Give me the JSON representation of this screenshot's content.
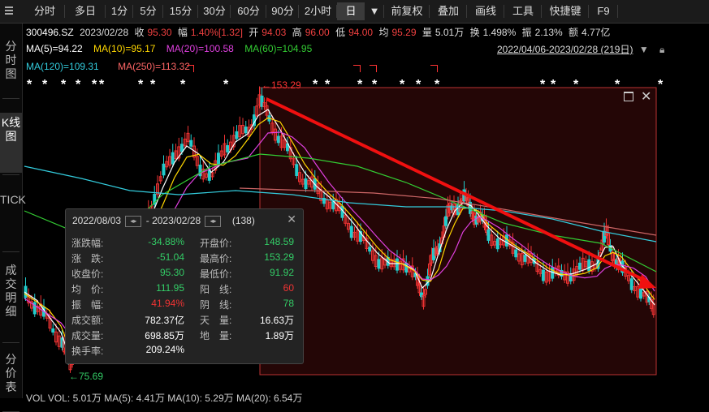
{
  "toolbar": {
    "items": [
      "分时",
      "多日",
      "1分",
      "5分",
      "15分",
      "30分",
      "60分",
      "90分",
      "2小时",
      "日",
      "▼",
      "前复权",
      "叠加",
      "画线",
      "工具",
      "快捷键",
      "F9"
    ],
    "active_index": 9
  },
  "sidebar": [
    "分时图",
    "K线图",
    "TICK",
    "成交明细",
    "分价表"
  ],
  "quote": {
    "code": "300496.SZ",
    "date": "2023/02/28",
    "close_label": "收",
    "close": "95.30",
    "chg_label": "幅",
    "chg": "1.40%[1.32]",
    "open_label": "开",
    "open": "94.03",
    "high_label": "高",
    "high": "96.00",
    "low_label": "低",
    "low": "94.00",
    "avg_label": "均",
    "avg": "95.29",
    "vol_label": "量",
    "vol": "5.01万",
    "turn_label": "换",
    "turn": "1.498%",
    "amp_label": "振",
    "amp": "2.13%",
    "amt_label": "额",
    "amt": "4.77亿"
  },
  "ma": {
    "ma5": "MA(5)=94.22",
    "ma10": "MA(10)=95.17",
    "ma20": "MA(20)=100.58",
    "ma60": "MA(60)=104.95",
    "ma120": "MA(120)=109.31",
    "ma250": "MA(250)=113.32",
    "range": "2022/04/06-2023/02/28 (219日)",
    "colors": {
      "ma5": "#ffffff",
      "ma10": "#ffd700",
      "ma20": "#e040e0",
      "ma60": "#33cc33",
      "ma120": "#33ccdd",
      "ma250": "#ff6666"
    }
  },
  "chart": {
    "high_label": "153.29",
    "low_label": "75.69"
  },
  "popup": {
    "start_date": "2022/08/03",
    "end_date": "2023/02/28",
    "count": "(138)",
    "rows": [
      {
        "l1": "涨跌幅:",
        "v1": "-34.88%",
        "c1": "green",
        "l2": "开盘价:",
        "v2": "148.59",
        "c2": "green"
      },
      {
        "l1": "涨　跌:",
        "v1": "-51.04",
        "c1": "green",
        "l2": "最高价:",
        "v2": "153.29",
        "c2": "green"
      },
      {
        "l1": "收盘价:",
        "v1": "95.30",
        "c1": "green",
        "l2": "最低价:",
        "v2": "91.92",
        "c2": "green"
      },
      {
        "l1": "均　价:",
        "v1": "111.95",
        "c1": "green",
        "l2": "阳　线:",
        "v2": "60",
        "c2": "red"
      },
      {
        "l1": "振　幅:",
        "v1": "41.94%",
        "c1": "red",
        "l2": "阴　线:",
        "v2": "78",
        "c2": "green"
      },
      {
        "l1": "成交额:",
        "v1": "782.37亿",
        "c1": "white",
        "l2": "天　量:",
        "v2": "16.63万",
        "c2": "white"
      },
      {
        "l1": "成交量:",
        "v1": "698.85万",
        "c1": "white",
        "l2": "地　量:",
        "v2": "1.89万",
        "c2": "white"
      },
      {
        "l1": "换手率:",
        "v1": "209.24%",
        "c1": "white",
        "l2": "",
        "v2": "",
        "c2": "white"
      }
    ]
  },
  "bottom": {
    "text": "VOL  VOL: 5.01万   MA(5): 4.41万   MA(10): 5.29万   MA(20): 6.54万"
  }
}
